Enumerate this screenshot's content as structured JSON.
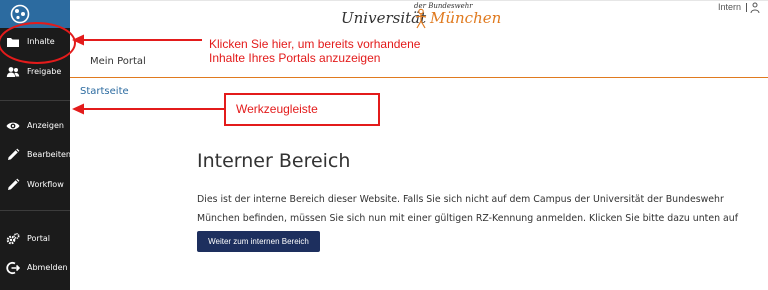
{
  "header": {
    "brand_small": "der Bundeswehr",
    "brand_university": "Universität",
    "brand_city": "München",
    "intern_label": "Intern"
  },
  "portal": {
    "title": "Mein Portal"
  },
  "breadcrumb": {
    "home": "Startseite"
  },
  "sidebar": {
    "items": [
      {
        "label": "Inhalte",
        "icon": "folder-icon"
      },
      {
        "label": "Freigabe",
        "icon": "users-icon"
      },
      {
        "label": "Anzeigen",
        "icon": "eye-icon"
      },
      {
        "label": "Bearbeiten",
        "icon": "pencil-icon"
      },
      {
        "label": "Workflow",
        "icon": "pencil-icon"
      },
      {
        "label": "Portal",
        "icon": "gears-icon"
      },
      {
        "label": "Abmelden",
        "icon": "logout-icon"
      }
    ]
  },
  "main": {
    "heading": "Interner Bereich",
    "paragraph": "Dies ist der interne Bereich dieser Website. Falls Sie sich nicht auf dem Campus der Universität der Bundeswehr München befinden, müssen Sie sich nun mit einer gültigen RZ-Kennung anmelden. Klicken Sie bitte dazu unten auf \"Weiter\".",
    "button_label": "Weiter zum internen Bereich"
  },
  "annotations": {
    "content_hint_line1": "Klicken Sie hier, um bereits vorhandene",
    "content_hint_line2": "Inhalte Ihres Portals anzuzeigen",
    "toolbar_label": "Werkzeugleiste"
  },
  "colors": {
    "sidebar_bg": "#1b1b1b",
    "logo_bg": "#2c6ba0",
    "accent_orange": "#e07a1f",
    "link_blue": "#2c6ba0",
    "button_bg": "#1d2f5e",
    "annotation_red": "#e31b1b"
  }
}
